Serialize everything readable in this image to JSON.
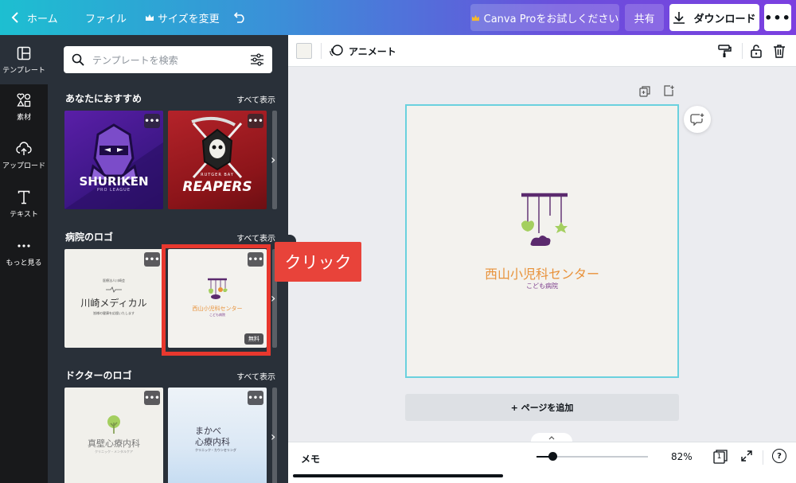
{
  "topbar": {
    "home": "ホーム",
    "file": "ファイル",
    "resize": "サイズを変更",
    "pro": "Canva Proをお試しください",
    "share": "共有",
    "download": "ダウンロード",
    "more": "•••"
  },
  "rail": {
    "items": [
      {
        "label": "テンプレート",
        "icon": "template-icon"
      },
      {
        "label": "素材",
        "icon": "elements-icon"
      },
      {
        "label": "アップロード",
        "icon": "upload-icon"
      },
      {
        "label": "テキスト",
        "icon": "text-icon"
      },
      {
        "label": "もっと見る",
        "icon": "more-icon"
      }
    ]
  },
  "panel": {
    "search_placeholder": "テンプレートを検索",
    "sections": [
      {
        "title": "あなたにおすすめ",
        "see_all": "すべて表示",
        "thumbs": [
          {
            "line1": "SHURIKEN",
            "line2": "PRO LEAGUE"
          },
          {
            "line1": "REAPERS",
            "line2": "RUTGER BAY"
          }
        ]
      },
      {
        "title": "病院のロゴ",
        "see_all": "すべて表示",
        "thumbs": [
          {
            "line1": "川崎メディカル",
            "line2": "医療法人川崎会",
            "line3": "皆様の健康を応援いたします"
          },
          {
            "line1": "西山小児科センター",
            "line2": "こども病院",
            "badge": "無料"
          }
        ]
      },
      {
        "title": "ドクターのロゴ",
        "see_all": "すべて表示",
        "thumbs": [
          {
            "line1": "真壁心療内科",
            "line2": "クリニック・メンタルケア"
          },
          {
            "line1": "まかべ",
            "line2": "心療内科",
            "line3": "クリニック・カウンセリング"
          }
        ]
      }
    ],
    "thumb_menu": "•••"
  },
  "toolbar2": {
    "animate": "アニメート"
  },
  "design": {
    "title": "西山小児科センター",
    "subtitle": "こども病院"
  },
  "add_page": "+ ページを追加",
  "bottombar": {
    "notes": "メモ",
    "zoom": "82%",
    "page_count": "1",
    "help": "?"
  },
  "annotation": {
    "callout": "クリック"
  },
  "colors": {
    "accent_gradient_start": "#1dbfd1",
    "accent_gradient_end": "#7b3fe0",
    "highlight_red": "#e8382e",
    "logo_orange": "#e8923a",
    "logo_purple": "#5b2a6e",
    "logo_green": "#a4cf5f"
  }
}
